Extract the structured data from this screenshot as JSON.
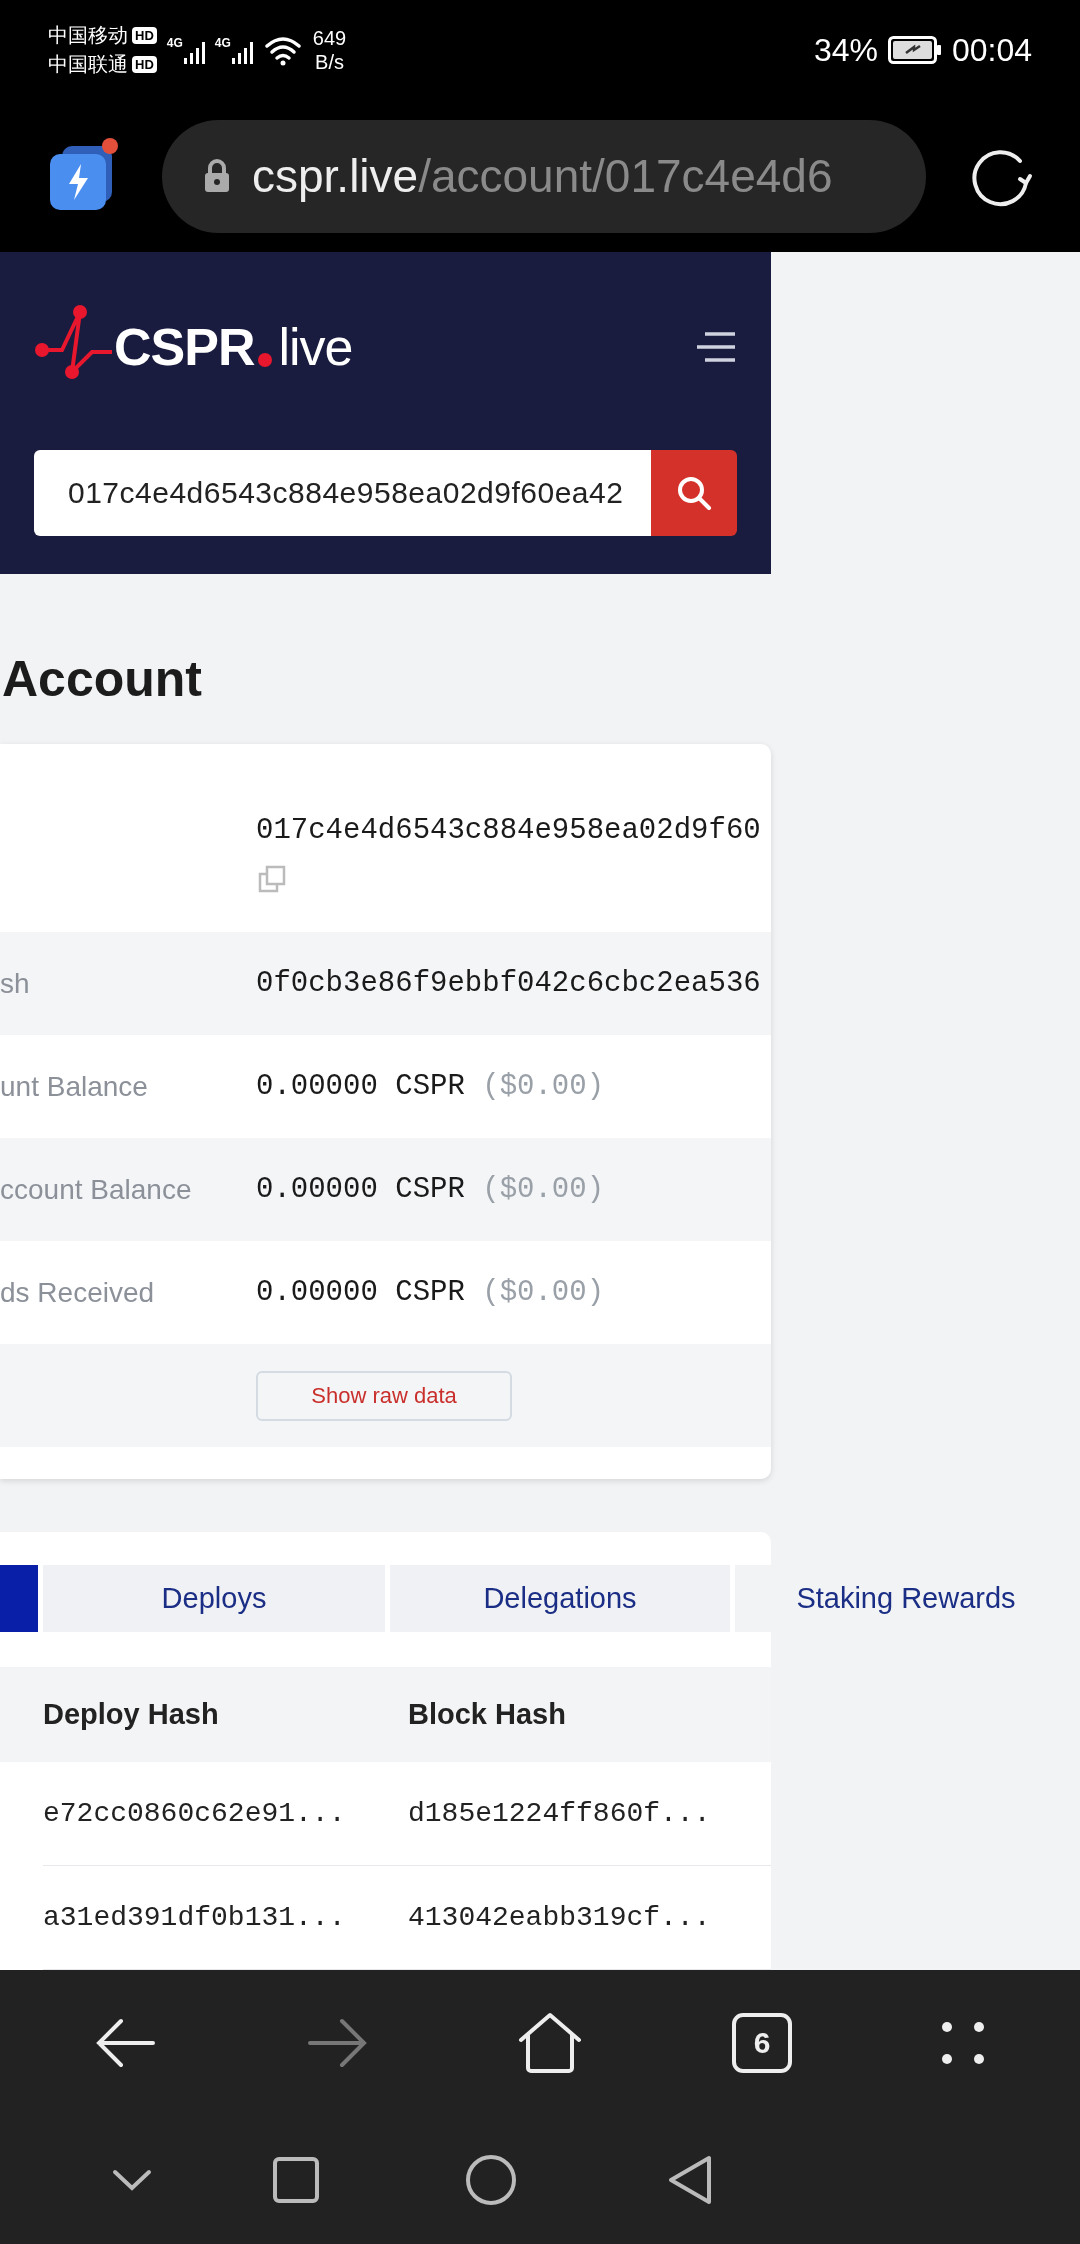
{
  "status_bar": {
    "carriers": [
      {
        "name": "中国移动",
        "badge": "HD",
        "network": "4G"
      },
      {
        "name": "中国联通",
        "badge": "HD",
        "network": "4G"
      }
    ],
    "net_speed": "649",
    "net_speed_unit": "B/s",
    "battery": "34%",
    "time": "00:04"
  },
  "address_bar": {
    "domain": "cspr.live",
    "path": "/account/017c4e4d6",
    "notification_dot": true
  },
  "site_header": {
    "logo_main": "CSPR",
    "logo_suffix": "live",
    "search": {
      "value": "017c4e4d6543c884e958ea02d9f60ea42"
    }
  },
  "page_title": "Account",
  "account_details": {
    "rows": [
      {
        "value": "017c4e4d6543c884e958ea02d9f60",
        "copy": true
      },
      {
        "label": "sh",
        "value": "0f0cb3e86f9ebbf042c6cbc2ea536"
      },
      {
        "label": "unt Balance",
        "value": "0.00000 CSPR",
        "fiat": "($0.00)"
      },
      {
        "label": "ccount Balance",
        "value": "0.00000 CSPR",
        "fiat": "($0.00)"
      },
      {
        "label": "ds Received",
        "value": "0.00000 CSPR",
        "fiat": "($0.00)"
      }
    ],
    "raw_data_button": "Show raw data"
  },
  "activity": {
    "tabs": [
      {
        "selected": true
      },
      {
        "label": "Deploys",
        "selected": false
      },
      {
        "label": "Delegations",
        "selected": false
      },
      {
        "label": "Staking Rewards",
        "selected": false
      }
    ],
    "table": {
      "columns": [
        "Deploy Hash",
        "Block Hash"
      ],
      "rows": [
        [
          "e72cc0860c62e91...",
          "d185e1224ff860f..."
        ],
        [
          "a31ed391df0b131...",
          "413042eabb319cf..."
        ]
      ]
    }
  },
  "browser_toolbar": [
    {
      "kind": "back",
      "disabled": false
    },
    {
      "kind": "forward",
      "disabled": true
    },
    {
      "kind": "home",
      "disabled": false
    },
    {
      "kind": "tabs",
      "count": "6",
      "disabled": false
    },
    {
      "kind": "menu",
      "disabled": false
    }
  ],
  "system_nav": [
    {
      "kind": "collapse"
    },
    {
      "kind": "recents"
    },
    {
      "kind": "home"
    },
    {
      "kind": "back"
    }
  ]
}
